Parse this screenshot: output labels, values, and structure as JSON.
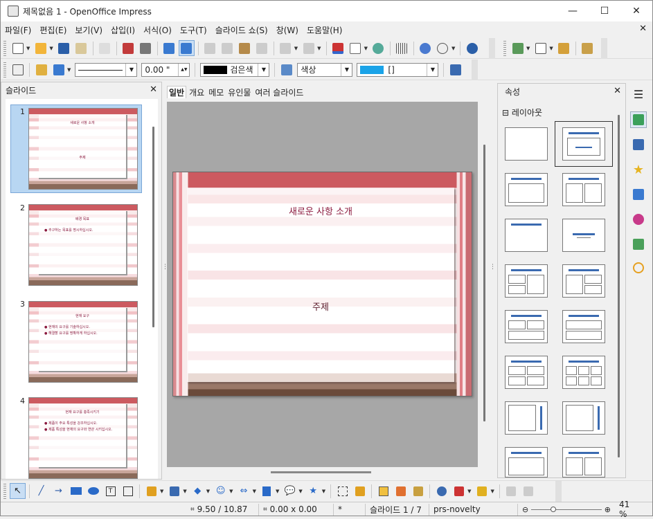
{
  "window": {
    "title": "제목없음 1 - OpenOffice Impress",
    "minimize": "—",
    "maximize": "☐",
    "close": "✕"
  },
  "menu": [
    "파일(F)",
    "편집(E)",
    "보기(V)",
    "삽입(I)",
    "서식(O)",
    "도구(T)",
    "슬라이드 쇼(S)",
    "창(W)",
    "도움말(H)"
  ],
  "menu_close": "✕",
  "format_bar": {
    "line_width": "0.00 \"",
    "line_color": "검은색",
    "area_style": "색상",
    "area_color": "[]"
  },
  "slides_panel": {
    "title": "슬라이드",
    "close": "✕",
    "slides": [
      {
        "number": "1",
        "title": "새로운 사항 소개",
        "lines": [
          "주제"
        ]
      },
      {
        "number": "2",
        "title": "배경 목표",
        "lines": [
          "추구하는 목표를 명시하십시오."
        ]
      },
      {
        "number": "3",
        "title": "현재 요구",
        "lines": [
          "현재의 요구를 기술하십시오.",
          "해결할 요구를 명확하게 하십시오."
        ]
      },
      {
        "number": "4",
        "title": "현재 요구를 충족시키기",
        "lines": [
          "제품이 주요 특성을 강조하십시오.",
          "제품 특성을 현재의 요구와 연관 시키십시오."
        ]
      }
    ]
  },
  "view_tabs": [
    "일반",
    "개요",
    "메모",
    "유인물",
    "여러 슬라이드"
  ],
  "main_slide": {
    "title": "새로운 사항 소개",
    "subtitle": "주제"
  },
  "properties_panel": {
    "title": "속성",
    "close": "✕",
    "section": "⊟ 레이아웃"
  },
  "status": {
    "position": "9.50 / 10.87",
    "size": "0.00 x 0.00",
    "modified": "*",
    "slide": "슬라이드 1 / 7",
    "master": "prs-novelty",
    "zoom": "41 %"
  },
  "colors": {
    "accent": "#cc5a60",
    "title_text": "#8b1a3e",
    "selection": "#b8d6f2",
    "area_color": "#1aa3e8"
  }
}
